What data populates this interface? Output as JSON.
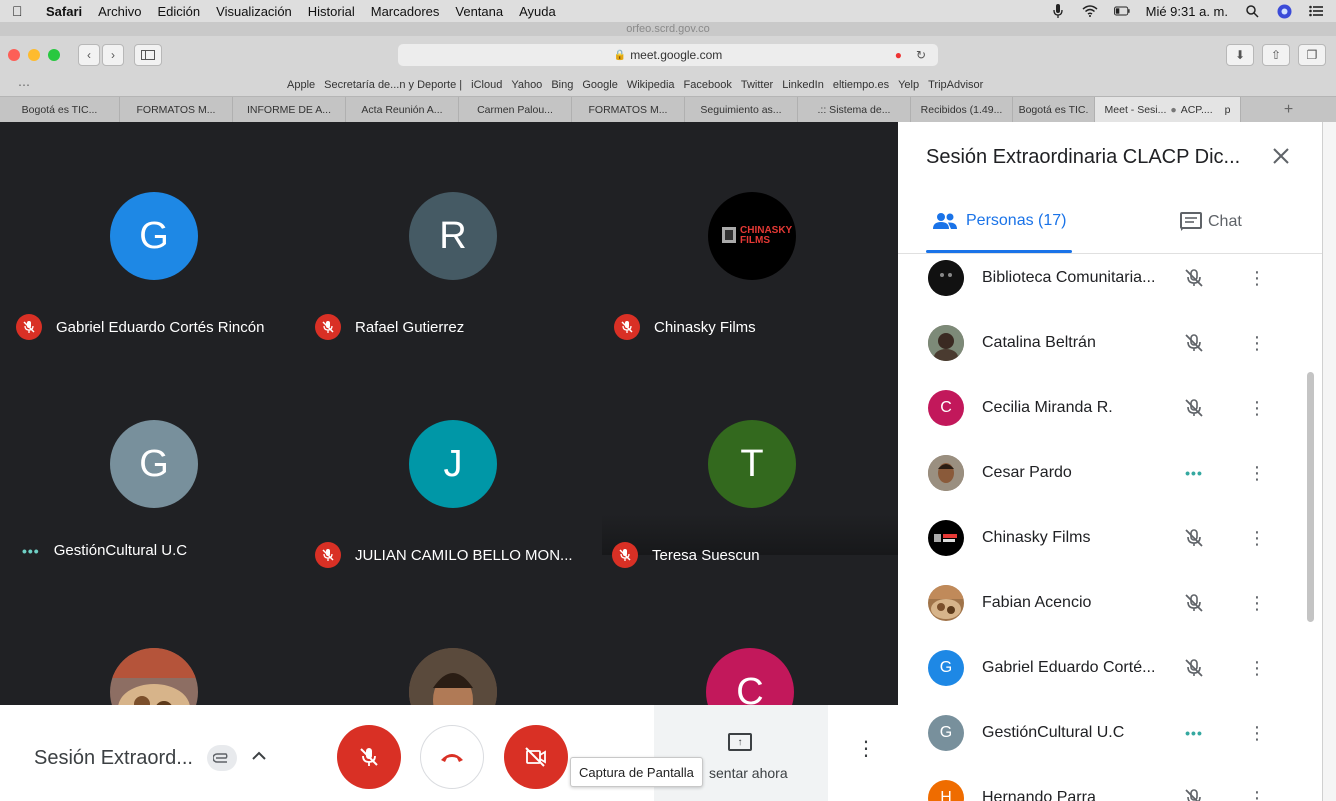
{
  "menubar": {
    "app": "Safari",
    "items": [
      "Archivo",
      "Edición",
      "Visualización",
      "Historial",
      "Marcadores",
      "Ventana",
      "Ayuda"
    ],
    "clock": "Mié 9:31 a. m."
  },
  "browser": {
    "background_window_url": "orfeo.scrd.gov.co",
    "url": "meet.google.com",
    "favorites": [
      "Apple",
      "Secretaría de...n y Deporte |",
      "iCloud",
      "Yahoo",
      "Bing",
      "Google",
      "Wikipedia",
      "Facebook",
      "Twitter",
      "LinkedIn",
      "eltiempo.es",
      "Yelp",
      "TripAdvisor"
    ],
    "tabs": [
      {
        "label": "Bogotá es TIC..."
      },
      {
        "label": "FORMATOS M..."
      },
      {
        "label": "INFORME DE A..."
      },
      {
        "label": "Acta Reunión A..."
      },
      {
        "label": "Carmen Palou..."
      },
      {
        "label": "FORMATOS M..."
      },
      {
        "label": "Seguimiento as..."
      },
      {
        "label": ".:: Sistema de..."
      },
      {
        "label": "Recibidos (1.49..."
      },
      {
        "label": "Bogotá es TIC."
      },
      {
        "label": "Meet - Sesi..."
      },
      {
        "label": "ACP...."
      },
      {
        "label": "p"
      }
    ]
  },
  "grid": {
    "tiles": [
      {
        "initial": "G",
        "name": "Gabriel Eduardo Cortés Rincón",
        "color": "#1e88e5",
        "status": "muted"
      },
      {
        "initial": "R",
        "name": "Rafael Gutierrez",
        "color": "#455a64",
        "status": "muted"
      },
      {
        "initial": "",
        "name": "Chinasky Films",
        "color": "#000000",
        "status": "muted",
        "logo": "CHINASKY FILMS"
      },
      {
        "initial": "G",
        "name": "GestiónCultural U.C",
        "color": "#78909c",
        "status": "speaking"
      },
      {
        "initial": "J",
        "name": "JULIAN CAMILO BELLO MON...",
        "color": "#0097a7",
        "status": "muted"
      },
      {
        "initial": "T",
        "name": "Teresa Suescun",
        "color": "#33691e",
        "status": "muted"
      },
      {
        "initial": "",
        "name": "",
        "color": "#8d6e63",
        "status": "none"
      },
      {
        "initial": "",
        "name": "",
        "color": "#6d4c41",
        "status": "none"
      },
      {
        "initial": "C",
        "name": "",
        "color": "#c2185b",
        "status": "none"
      }
    ]
  },
  "bottombar": {
    "meeting_title": "Sesión Extraord...",
    "present_label": "sentar ahora",
    "tooltip": "Captura de Pantalla"
  },
  "panel": {
    "title": "Sesión Extraordinaria CLACP Dic...",
    "people_tab": "Personas (17)",
    "chat_tab": "Chat",
    "participants": [
      {
        "initial": "",
        "name": "Biblioteca Comunitaria...",
        "color": "#111111",
        "status": "muted"
      },
      {
        "initial": "",
        "name": "Catalina Beltrán",
        "color": "#6b5b4e",
        "status": "muted"
      },
      {
        "initial": "C",
        "name": "Cecilia Miranda R.",
        "color": "#c2185b",
        "status": "muted"
      },
      {
        "initial": "",
        "name": "Cesar Pardo",
        "color": "#7a6450",
        "status": "speaking"
      },
      {
        "initial": "",
        "name": "Chinasky Films",
        "color": "#000000",
        "status": "muted"
      },
      {
        "initial": "",
        "name": "Fabian Acencio",
        "color": "#a0744a",
        "status": "muted"
      },
      {
        "initial": "G",
        "name": "Gabriel Eduardo Corté...",
        "color": "#1e88e5",
        "status": "muted"
      },
      {
        "initial": "G",
        "name": "GestiónCultural U.C",
        "color": "#78909c",
        "status": "speaking"
      },
      {
        "initial": "H",
        "name": "Hernando Parra",
        "color": "#ef6c00",
        "status": "muted"
      }
    ]
  }
}
